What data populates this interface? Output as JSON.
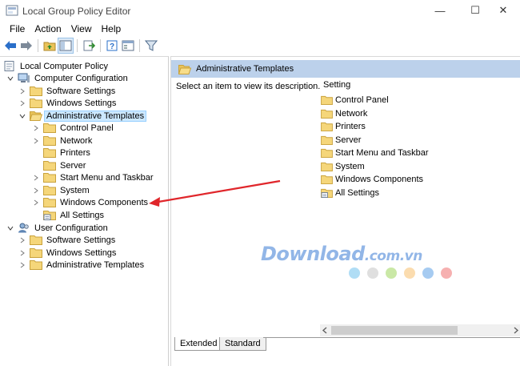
{
  "window": {
    "title": "Local Group Policy Editor",
    "minimize": "—",
    "maximize": "☐",
    "close": "✕"
  },
  "menu": [
    "File",
    "Action",
    "View",
    "Help"
  ],
  "tree": {
    "root": "Local Computer Policy",
    "computer_config": "Computer Configuration",
    "cc_software": "Software Settings",
    "cc_windows": "Windows Settings",
    "cc_admin": "Administrative Templates",
    "cc_admin_children": [
      "Control Panel",
      "Network",
      "Printers",
      "Server",
      "Start Menu and Taskbar",
      "System",
      "Windows Components",
      "All Settings"
    ],
    "user_config": "User Configuration",
    "uc_software": "Software Settings",
    "uc_windows": "Windows Settings",
    "uc_admin": "Administrative Templates"
  },
  "right": {
    "header": "Administrative Templates",
    "description": "Select an item to view its description.",
    "column_header": "Setting",
    "items": [
      "Control Panel",
      "Network",
      "Printers",
      "Server",
      "Start Menu and Taskbar",
      "System",
      "Windows Components",
      "All Settings"
    ]
  },
  "tabs": {
    "extended": "Extended",
    "standard": "Standard"
  },
  "watermark": {
    "brand": "Download",
    "suffix": ".com.vn"
  },
  "colors": {
    "selection": "#cce8ff",
    "header_bg": "#bcd1eb",
    "folder": "#f5d67a",
    "arrow": "#e0262b",
    "dots": [
      "#7cc6ee",
      "#c9c9c9",
      "#a6d86b",
      "#f9c57a",
      "#6aa8e8",
      "#f07b7b"
    ]
  }
}
